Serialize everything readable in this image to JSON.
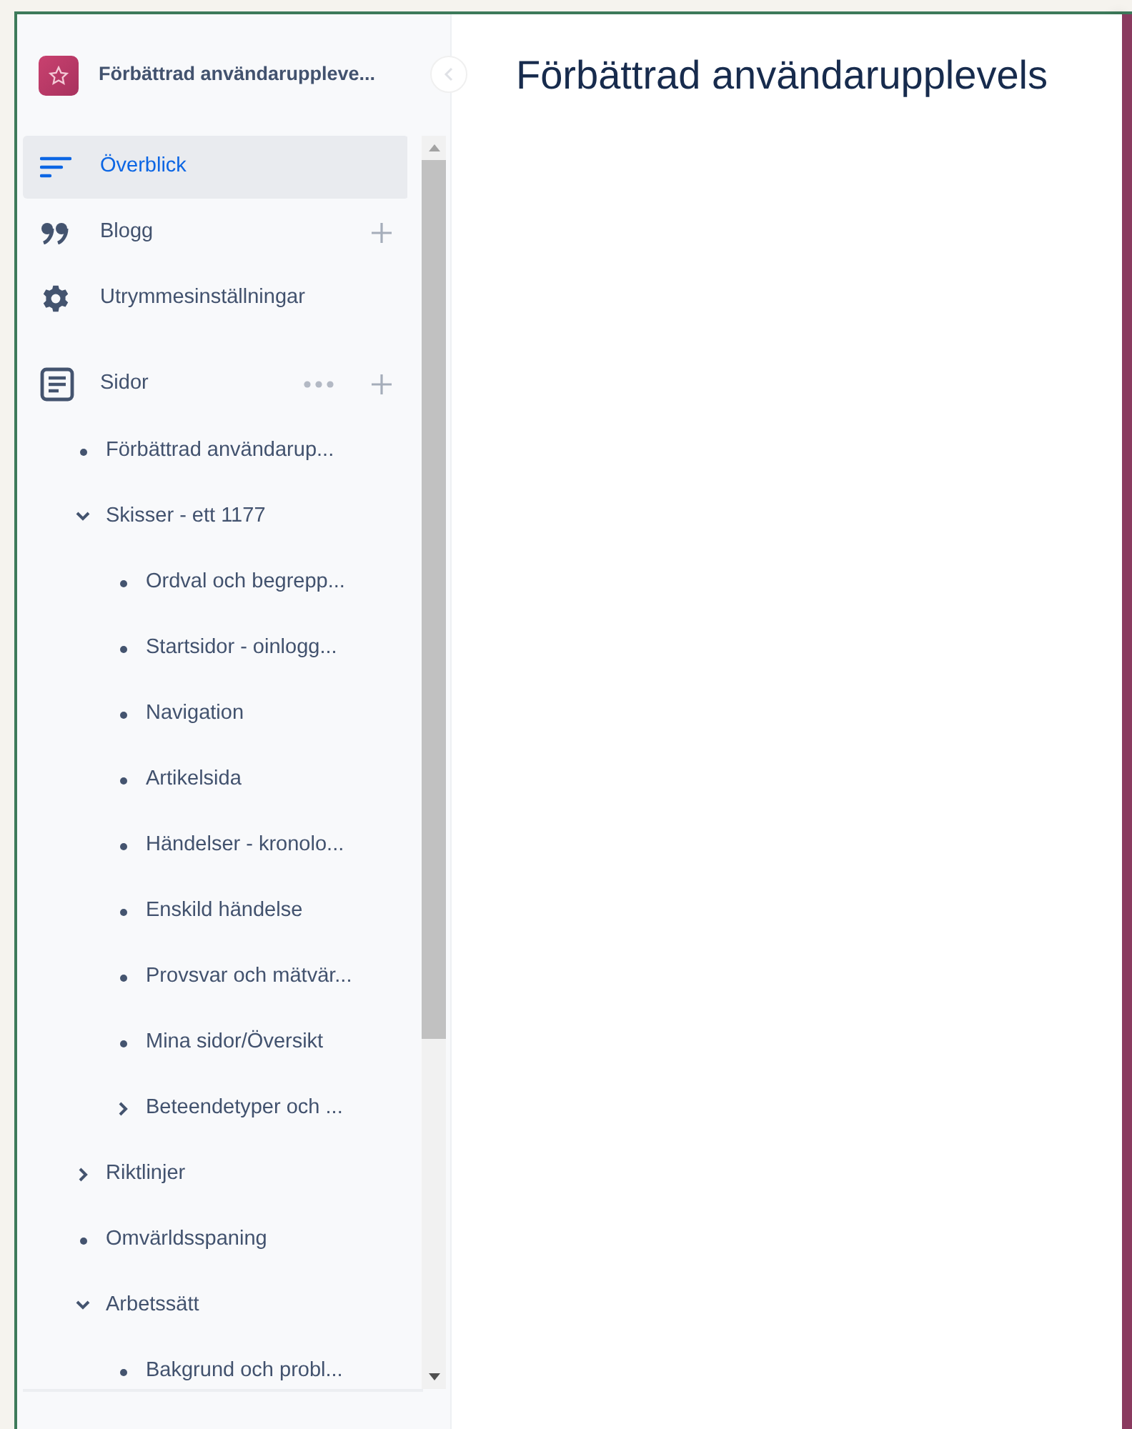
{
  "space": {
    "name": "Förbättrad användaruppleve..."
  },
  "nav": [
    {
      "kind": "overview",
      "label": "Överblick",
      "selected": true,
      "add": false
    },
    {
      "kind": "blog",
      "label": "Blogg",
      "selected": false,
      "add": true
    },
    {
      "kind": "settings",
      "label": "Utrymmesinställningar",
      "selected": false,
      "add": false
    }
  ],
  "pages_section": {
    "label": "Sidor"
  },
  "page_tree": [
    {
      "kind": "page",
      "label": "Förbättrad användarup..."
    },
    {
      "kind": "folder",
      "label": "Skisser - ett 1177",
      "expanded": true,
      "children": [
        {
          "kind": "page",
          "label": "Ordval och begrepp..."
        },
        {
          "kind": "page",
          "label": "Startsidor - oinlogg..."
        },
        {
          "kind": "page",
          "label": "Navigation"
        },
        {
          "kind": "page",
          "label": "Artikelsida"
        },
        {
          "kind": "page",
          "label": "Händelser - kronolo..."
        },
        {
          "kind": "page",
          "label": "Enskild händelse"
        },
        {
          "kind": "page",
          "label": "Provsvar och mätvär..."
        },
        {
          "kind": "page",
          "label": "Mina sidor/Översikt"
        },
        {
          "kind": "folder",
          "label": "Beteendetyper och ...",
          "expanded": false
        }
      ]
    },
    {
      "kind": "folder",
      "label": "Riktlinjer",
      "expanded": false
    },
    {
      "kind": "page",
      "label": "Omvärldsspaning"
    },
    {
      "kind": "folder",
      "label": "Arbetssätt",
      "expanded": true,
      "children": [
        {
          "kind": "page",
          "label": "Bakgrund och probl..."
        }
      ]
    }
  ],
  "page": {
    "title": "Förbättrad användarupplevels"
  }
}
